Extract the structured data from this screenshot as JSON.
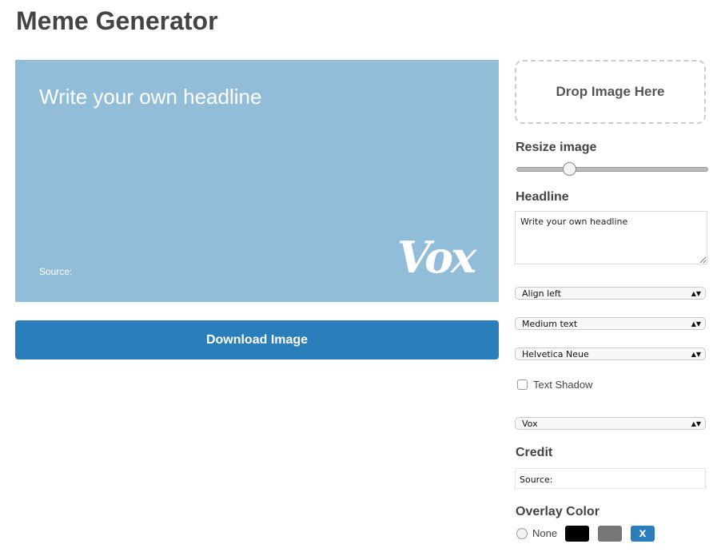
{
  "title": "Meme Generator",
  "canvas": {
    "headline": "Write your own headline",
    "source": "Source:",
    "logo": "Vox",
    "background": "#92bdd9"
  },
  "download_label": "Download Image",
  "drop_label": "Drop Image Here",
  "resize": {
    "label": "Resize image",
    "value_fraction": 0.26
  },
  "headline": {
    "label": "Headline",
    "value": "Write your own headline"
  },
  "selects": {
    "align": "Align left",
    "size": "Medium text",
    "font": "Helvetica Neue",
    "watermark": "Vox"
  },
  "shadow_label": "Text Shadow",
  "credit": {
    "label": "Credit",
    "value": "Source:"
  },
  "overlay": {
    "label": "Overlay Color",
    "none": "None",
    "swatches": [
      "#000000",
      "#777777",
      "#2a7fba"
    ],
    "selected_mark": "x"
  }
}
